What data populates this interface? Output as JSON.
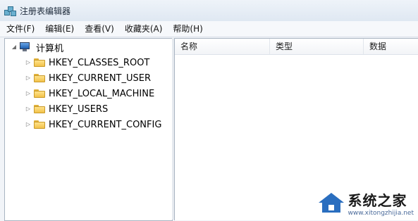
{
  "window": {
    "title": "注册表编辑器"
  },
  "menu": [
    {
      "label": "文件(F)"
    },
    {
      "label": "编辑(E)"
    },
    {
      "label": "查看(V)"
    },
    {
      "label": "收藏夹(A)"
    },
    {
      "label": "帮助(H)"
    }
  ],
  "tree": {
    "root": {
      "label": "计算机",
      "expander": "◢",
      "icon": "computer-icon"
    },
    "children": [
      {
        "label": "HKEY_CLASSES_ROOT",
        "expander": "▷",
        "icon": "folder-icon"
      },
      {
        "label": "HKEY_CURRENT_USER",
        "expander": "▷",
        "icon": "folder-icon"
      },
      {
        "label": "HKEY_LOCAL_MACHINE",
        "expander": "▷",
        "icon": "folder-icon"
      },
      {
        "label": "HKEY_USERS",
        "expander": "▷",
        "icon": "folder-icon"
      },
      {
        "label": "HKEY_CURRENT_CONFIG",
        "expander": "▷",
        "icon": "folder-icon"
      }
    ]
  },
  "list": {
    "columns": [
      {
        "label": "名称"
      },
      {
        "label": "类型"
      },
      {
        "label": "数据"
      }
    ]
  },
  "watermark": {
    "text": "系统之家",
    "url": "www.xitongzhijia.net"
  }
}
